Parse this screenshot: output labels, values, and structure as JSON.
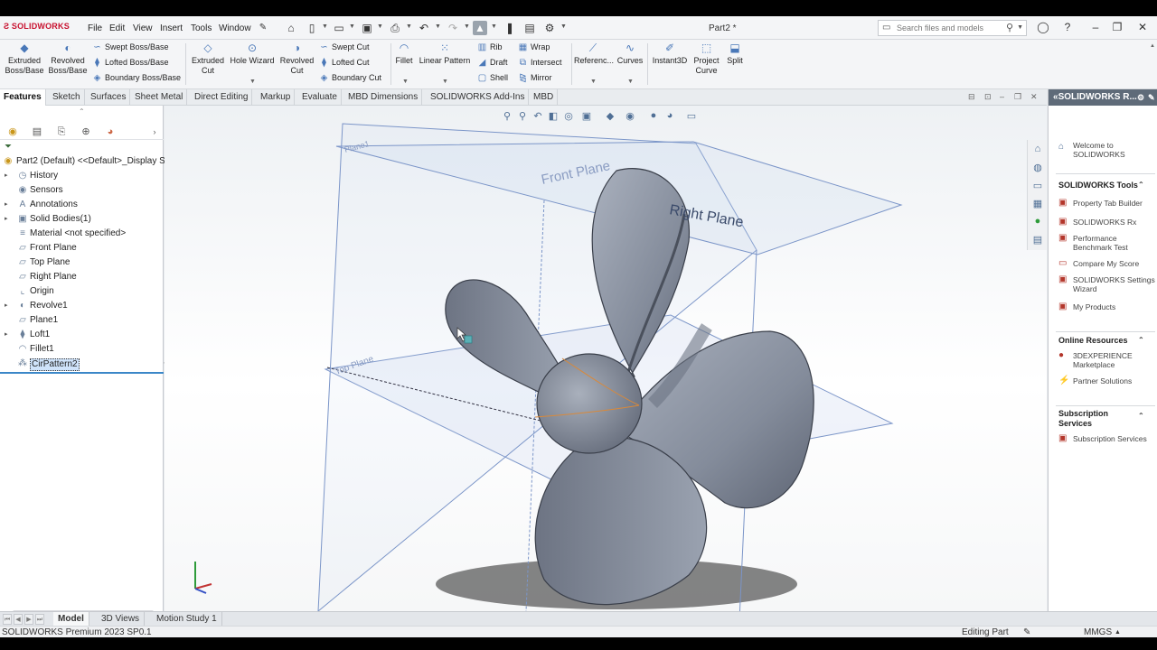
{
  "app": {
    "brand": "SOLIDWORKS",
    "doc_title": "Part2 *"
  },
  "menu": {
    "items": [
      "File",
      "Edit",
      "View",
      "Insert",
      "Tools",
      "Window"
    ]
  },
  "search": {
    "placeholder": "Search files and models"
  },
  "ribbon": {
    "extruded_boss": "Extruded Boss/Base",
    "revolved_boss": "Revolved Boss/Base",
    "swept_boss": "Swept Boss/Base",
    "lofted_boss": "Lofted Boss/Base",
    "boundary_boss": "Boundary Boss/Base",
    "extruded_cut": "Extruded Cut",
    "hole_wizard": "Hole Wizard",
    "revolved_cut": "Revolved Cut",
    "swept_cut": "Swept Cut",
    "lofted_cut": "Lofted Cut",
    "boundary_cut": "Boundary Cut",
    "fillet": "Fillet",
    "linear_pattern": "Linear Pattern",
    "rib": "Rib",
    "draft": "Draft",
    "shell": "Shell",
    "wrap": "Wrap",
    "intersect": "Intersect",
    "mirror": "Mirror",
    "reference": "Referenc...",
    "curves": "Curves",
    "instant3d": "Instant3D",
    "project_curve": "Project Curve",
    "split": "Split"
  },
  "tabs": [
    "Features",
    "Sketch",
    "Surfaces",
    "Sheet Metal",
    "Direct Editing",
    "Markup",
    "Evaluate",
    "MBD Dimensions",
    "SOLIDWORKS Add-Ins",
    "MBD"
  ],
  "tree": {
    "root": "Part2 (Default) <<Default>_Display S",
    "items": [
      {
        "label": "History",
        "icon": "history-icon",
        "expandable": true
      },
      {
        "label": "Sensors",
        "icon": "sensor-icon",
        "expandable": false
      },
      {
        "label": "Annotations",
        "icon": "annotation-icon",
        "expandable": true
      },
      {
        "label": "Solid Bodies(1)",
        "icon": "solid-bodies-icon",
        "expandable": true
      },
      {
        "label": "Material <not specified>",
        "icon": "material-icon",
        "expandable": false
      },
      {
        "label": "Front Plane",
        "icon": "plane-icon",
        "expandable": false
      },
      {
        "label": "Top Plane",
        "icon": "plane-icon",
        "expandable": false
      },
      {
        "label": "Right Plane",
        "icon": "plane-icon",
        "expandable": false
      },
      {
        "label": "Origin",
        "icon": "origin-icon",
        "expandable": false
      },
      {
        "label": "Revolve1",
        "icon": "revolve-icon",
        "expandable": true
      },
      {
        "label": "Plane1",
        "icon": "plane-icon",
        "expandable": false
      },
      {
        "label": "Loft1",
        "icon": "loft-icon",
        "expandable": true
      },
      {
        "label": "Fillet1",
        "icon": "fillet-icon",
        "expandable": false
      },
      {
        "label": "CirPattern2",
        "icon": "circular-pattern-icon",
        "expandable": false,
        "selected": true
      }
    ]
  },
  "viewport": {
    "plane_labels": [
      "Front Plane",
      "Right Plane",
      "Top Plane",
      "Plane1"
    ]
  },
  "taskpane": {
    "header": "SOLIDWORKS R...",
    "welcome": "Welcome to SOLIDWORKS",
    "tools_title": "SOLIDWORKS Tools",
    "tools": [
      "Property Tab Builder",
      "SOLIDWORKS Rx",
      "Performance Benchmark Test",
      "Compare My Score",
      "SOLIDWORKS Settings Wizard",
      "My Products"
    ],
    "online_title": "Online Resources",
    "online": [
      "3DEXPERIENCE Marketplace",
      "Partner Solutions"
    ],
    "subscription_title": "Subscription Services",
    "subscription": [
      "Subscription Services"
    ]
  },
  "bottom_tabs": [
    "Model",
    "3D Views",
    "Motion Study 1"
  ],
  "status": {
    "version": "SOLIDWORKS Premium 2023 SP0.1",
    "mode": "Editing Part",
    "units": "MMGS"
  },
  "colors": {
    "brand_red": "#c8102e",
    "model_gray": "#7a8394",
    "plane_blue": "#7b95c8",
    "selection_blue": "#cfe3fa"
  }
}
